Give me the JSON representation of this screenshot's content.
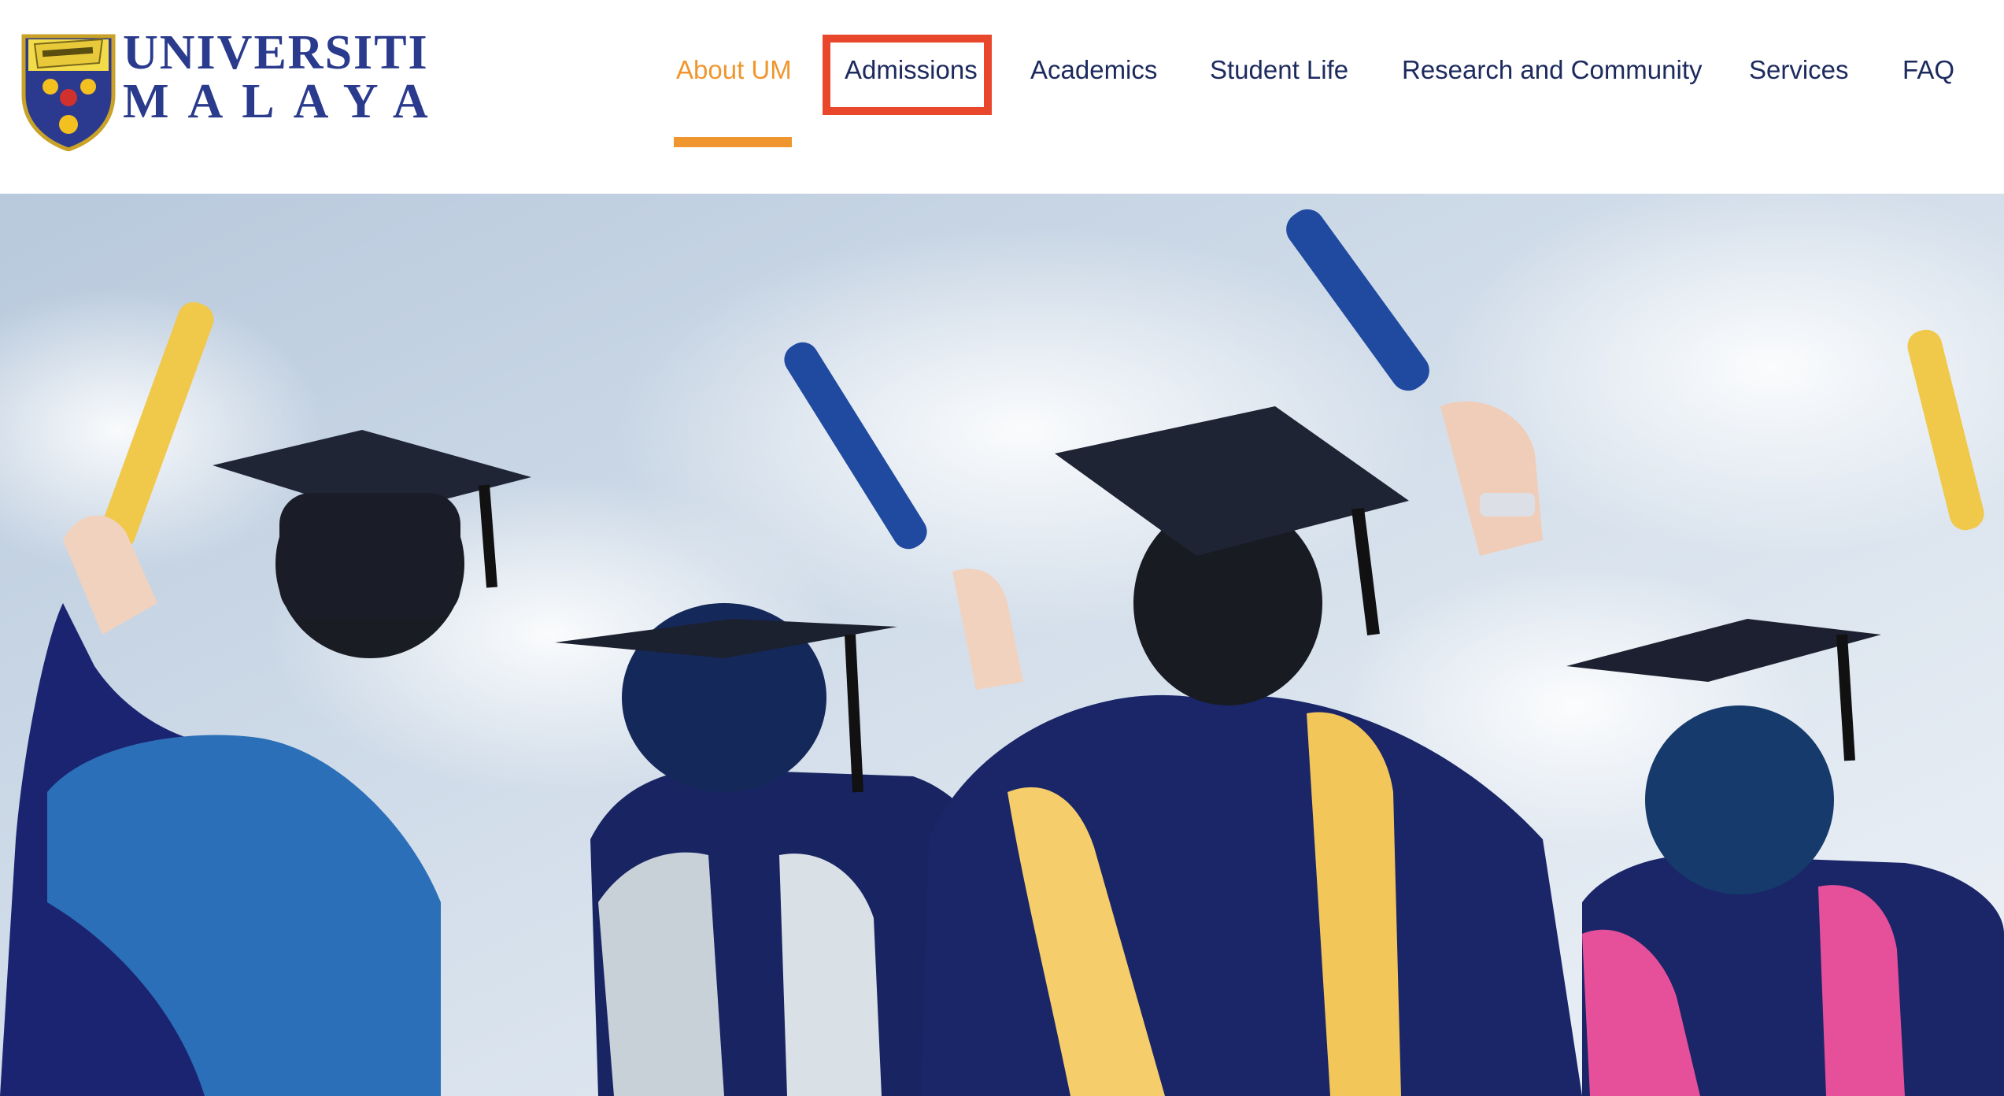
{
  "logo": {
    "line1": "UNIVERSITI",
    "line2": "MALAYA"
  },
  "nav": {
    "items": [
      {
        "label": "About UM",
        "active": true
      },
      {
        "label": "Admissions",
        "active": false,
        "highlighted": true
      },
      {
        "label": "Academics",
        "active": false
      },
      {
        "label": "Student Life",
        "active": false
      },
      {
        "label": "Research and Community",
        "active": false
      },
      {
        "label": "Services",
        "active": false
      },
      {
        "label": "FAQ",
        "active": false
      }
    ]
  },
  "colors": {
    "brand_navy": "#1c2a5e",
    "accent_orange": "#f0962e",
    "highlight_red": "#e8472b",
    "logo_blue": "#2a3a8c"
  },
  "icons": {
    "logo": "university-crest-icon",
    "tube_text": "UNIVERSITI MALAYA"
  }
}
